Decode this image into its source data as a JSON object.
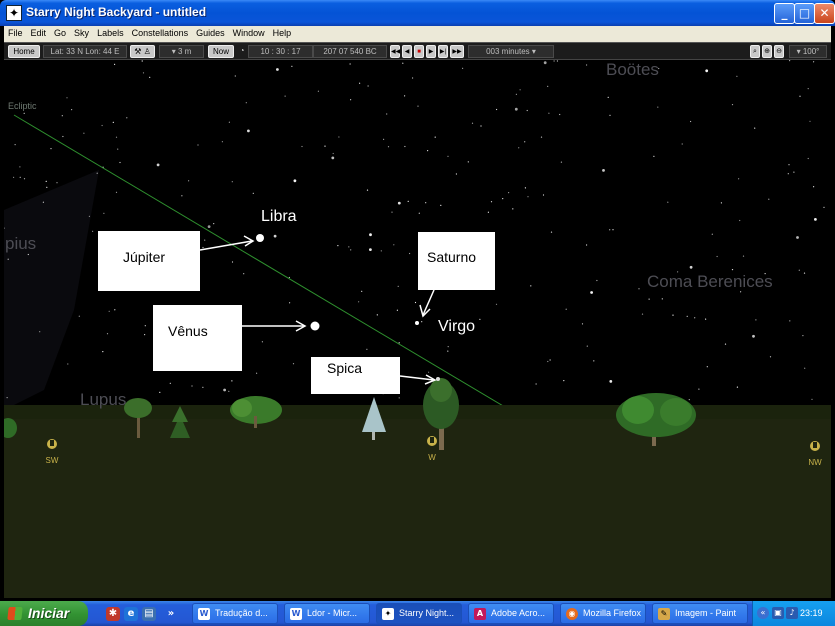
{
  "window": {
    "title": "Starry Night Backyard - untitled",
    "app_icon": "starry-night-icon",
    "controls": {
      "minimize": "_",
      "maximize": "□",
      "close": "✕"
    }
  },
  "menu": [
    "File",
    "Edit",
    "Go",
    "Sky",
    "Labels",
    "Constellations",
    "Guides",
    "Window",
    "Help"
  ],
  "toolbar": {
    "home_label": "Home",
    "location": "Lat: 33 N  Lon: 44 E",
    "elevation": "▾ 3 m",
    "now_label": "Now",
    "time": "10 : 30 : 17",
    "date": "207  07  540 BC",
    "time_step": "003 minutes ▾",
    "fov": "▾ 100°"
  },
  "sky": {
    "ecliptic_label": "Ecliptic",
    "constellations": [
      "Boötes",
      "Coma Berenices",
      "Libra",
      "Virgo",
      "Lupus",
      "pius"
    ],
    "callouts": {
      "jupiter": "Júpiter",
      "saturno": "Saturno",
      "venus": "Vênus",
      "spica": "Spica"
    },
    "directions": {
      "sw": "SW",
      "w": "W",
      "nw": "NW"
    },
    "colors": {
      "sky": "#000000",
      "ground": "#1f2510",
      "ecliptic": "#2e8f2e"
    }
  },
  "taskbar": {
    "start_label": "Iniciar",
    "items": [
      {
        "label": "Tradução d...",
        "icon": "word-icon"
      },
      {
        "label": "Ldor - Micr...",
        "icon": "word-icon"
      },
      {
        "label": "Starry Night...",
        "icon": "starry-night-icon"
      },
      {
        "label": "Adobe Acro...",
        "icon": "acrobat-icon"
      },
      {
        "label": "Mozilla Firefox",
        "icon": "firefox-icon"
      },
      {
        "label": "Imagem - Paint",
        "icon": "paint-icon"
      }
    ],
    "clock": "23:19"
  }
}
